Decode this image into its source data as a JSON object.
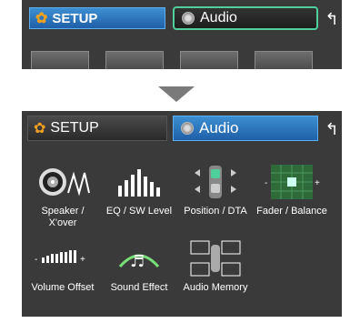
{
  "top": {
    "setup_tab": "SETUP",
    "audio_tab": "Audio"
  },
  "bottom": {
    "setup_tab": "SETUP",
    "audio_tab": "Audio",
    "tiles": [
      {
        "label": "Speaker / X'over"
      },
      {
        "label": "EQ / SW Level"
      },
      {
        "label": "Position / DTA"
      },
      {
        "label": "Fader / Balance"
      },
      {
        "label": "Volume Offset"
      },
      {
        "label": "Sound Effect"
      },
      {
        "label": "Audio Memory"
      }
    ]
  },
  "colors": {
    "panel_bg": "#3a3a3a",
    "active_tab": "#2a76c0",
    "focus_border": "#4ecf9c",
    "arrow": "#7a7a7a"
  }
}
